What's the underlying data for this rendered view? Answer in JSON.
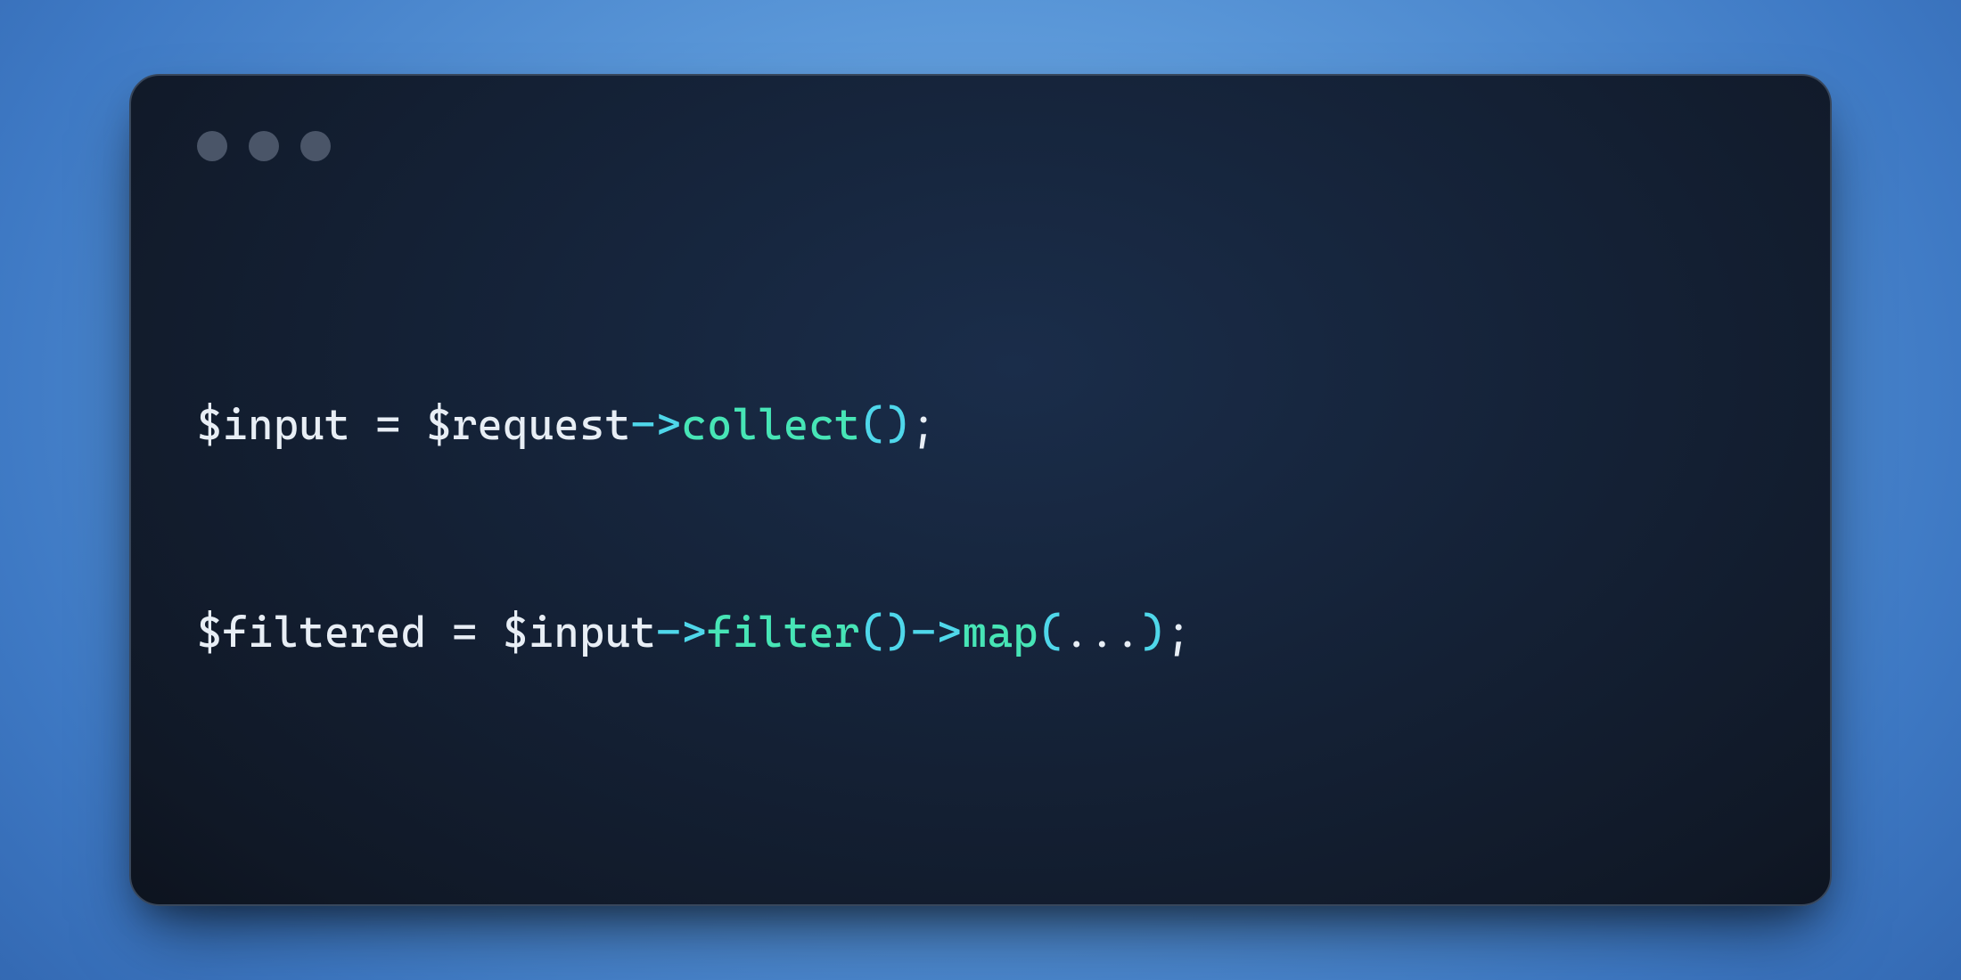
{
  "editor": {
    "line1": {
      "var1": "$input",
      "space": " ",
      "assign": "=",
      "var2": "$request",
      "arrow": "->",
      "method": "collect",
      "paren_open": "(",
      "paren_close": ")",
      "semi": ";"
    },
    "line2": {
      "var1": "$filtered",
      "space": " ",
      "assign": "=",
      "var2": "$input",
      "arrow1": "->",
      "method1": "filter",
      "paren_open1": "(",
      "paren_close1": ")",
      "arrow2": "->",
      "method2": "map",
      "paren_open2": "(",
      "dots": "...",
      "paren_close2": ")",
      "semi": ";"
    }
  }
}
